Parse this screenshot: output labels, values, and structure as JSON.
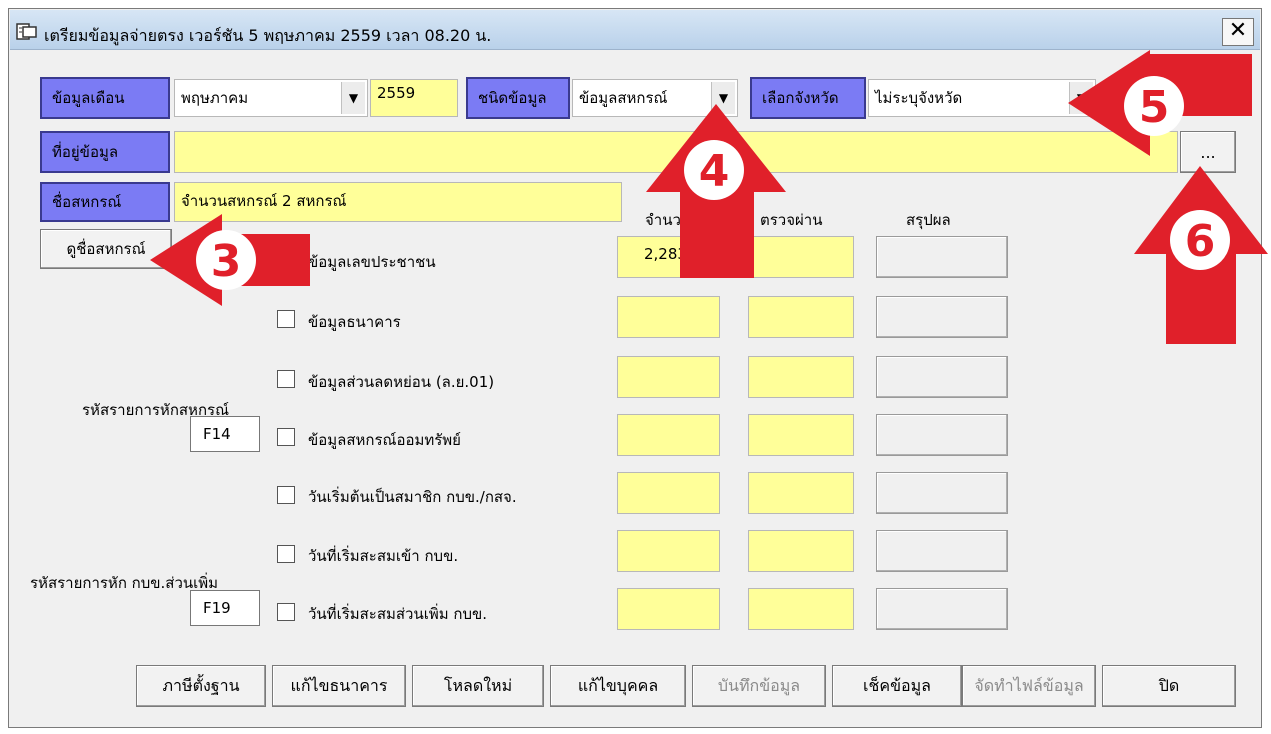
{
  "window": {
    "title": "เตรียมข้อมูลจ่ายตรง เวอร์ชัน 5 พฤษภาคม 2559 เวลา 08.20 น.",
    "close_label": "✕"
  },
  "month_row": {
    "month_label": "ข้อมูลเดือน",
    "month_value": "พฤษภาคม",
    "year_value": "2559",
    "type_label": "ชนิดข้อมูล",
    "type_value": "ข้อมูลสหกรณ์",
    "province_label": "เลือกจังหวัด",
    "province_value": "ไม่ระบุจังหวัด"
  },
  "path_row": {
    "label": "ที่อยู่ข้อมูล",
    "value": "",
    "browse_label": "..."
  },
  "coop_row": {
    "label": "ชื่อสหกรณ์",
    "value": "จำนวนสหกรณ์ 2 สหกรณ์",
    "view_button": "ดูชื่อสหกรณ์"
  },
  "columns": {
    "count": "จำนวน",
    "passed": "ตรวจผ่าน",
    "summary": "สรุปผล"
  },
  "rows": [
    {
      "label": "ข้อมูลเลขประชาชน",
      "count": "2,283"
    },
    {
      "label": "ข้อมูลธนาคาร",
      "count": ""
    },
    {
      "label": "ข้อมูลส่วนลดหย่อน (ล.ย.01)",
      "count": ""
    },
    {
      "label": "ข้อมูลสหกรณ์ออมทรัพย์",
      "count": ""
    },
    {
      "label": "วันเริ่มต้นเป็นสมาชิก กบข./กสจ.",
      "count": ""
    },
    {
      "label": "วันที่เริ่มสะสมเข้า กบข.",
      "count": ""
    },
    {
      "label": "วันที่เริ่มสะสมส่วนเพิ่ม กบข.",
      "count": ""
    }
  ],
  "deduction_codes": {
    "coop_label": "รหัสรายการหักสหกรณ์",
    "coop_code": "F14",
    "gpf_label": "รหัสรายการหัก กบข.ส่วนเพิ่ม",
    "gpf_code": "F19"
  },
  "buttons": {
    "tax": "ภาษีตั้งฐาน",
    "edit_bank": "แก้ไขธนาคาร",
    "reload": "โหลดใหม่",
    "edit_person": "แก้ไขบุคคล",
    "save": "บันทึกข้อมูล",
    "check": "เช็คข้อมูล",
    "make_file": "จัดทำไฟล์ข้อมูล",
    "close": "ปิด"
  },
  "annotations": {
    "n3": "3",
    "n4": "4",
    "n5": "5",
    "n6": "6"
  },
  "colors": {
    "label_bg": "#7b7bf4",
    "field_yellow": "#ffff99",
    "arrow_red": "#e0202a"
  }
}
